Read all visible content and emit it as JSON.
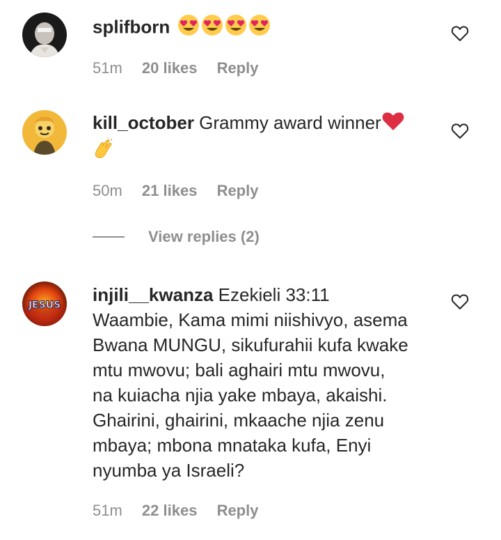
{
  "comments": [
    {
      "username": "splifborn",
      "text": "",
      "emoji": [
        "heart-eyes",
        "heart-eyes",
        "heart-eyes",
        "heart-eyes"
      ],
      "time": "51m",
      "likes": "20 likes",
      "reply": "Reply"
    },
    {
      "username": "kill_october",
      "text": "Grammy award winner",
      "emoji": [
        "red-heart",
        "clapping-hands"
      ],
      "time": "50m",
      "likes": "21 likes",
      "reply": "Reply",
      "view_replies": "View replies (2)"
    },
    {
      "username": "injili__kwanza",
      "text": "Ezekieli 33:11",
      "lines": [
        "Waambie, Kama mimi niishivyo, asema",
        "Bwana MUNGU, sikufurahii kufa kwake",
        "mtu mwovu; bali aghairi mtu mwovu,",
        "na kuiacha njia yake mbaya, akaishi.",
        "Ghairini, ghairini, mkaache njia zenu",
        "mbaya; mbona mnataka kufa, Enyi",
        "nyumba ya Israeli?"
      ],
      "avatar_text": "JESUS",
      "time": "51m",
      "likes": "22 likes",
      "reply": "Reply"
    }
  ],
  "colors": {
    "text": "#262626",
    "secondary": "#8e8e8e",
    "heart_red": "#e0245e"
  }
}
